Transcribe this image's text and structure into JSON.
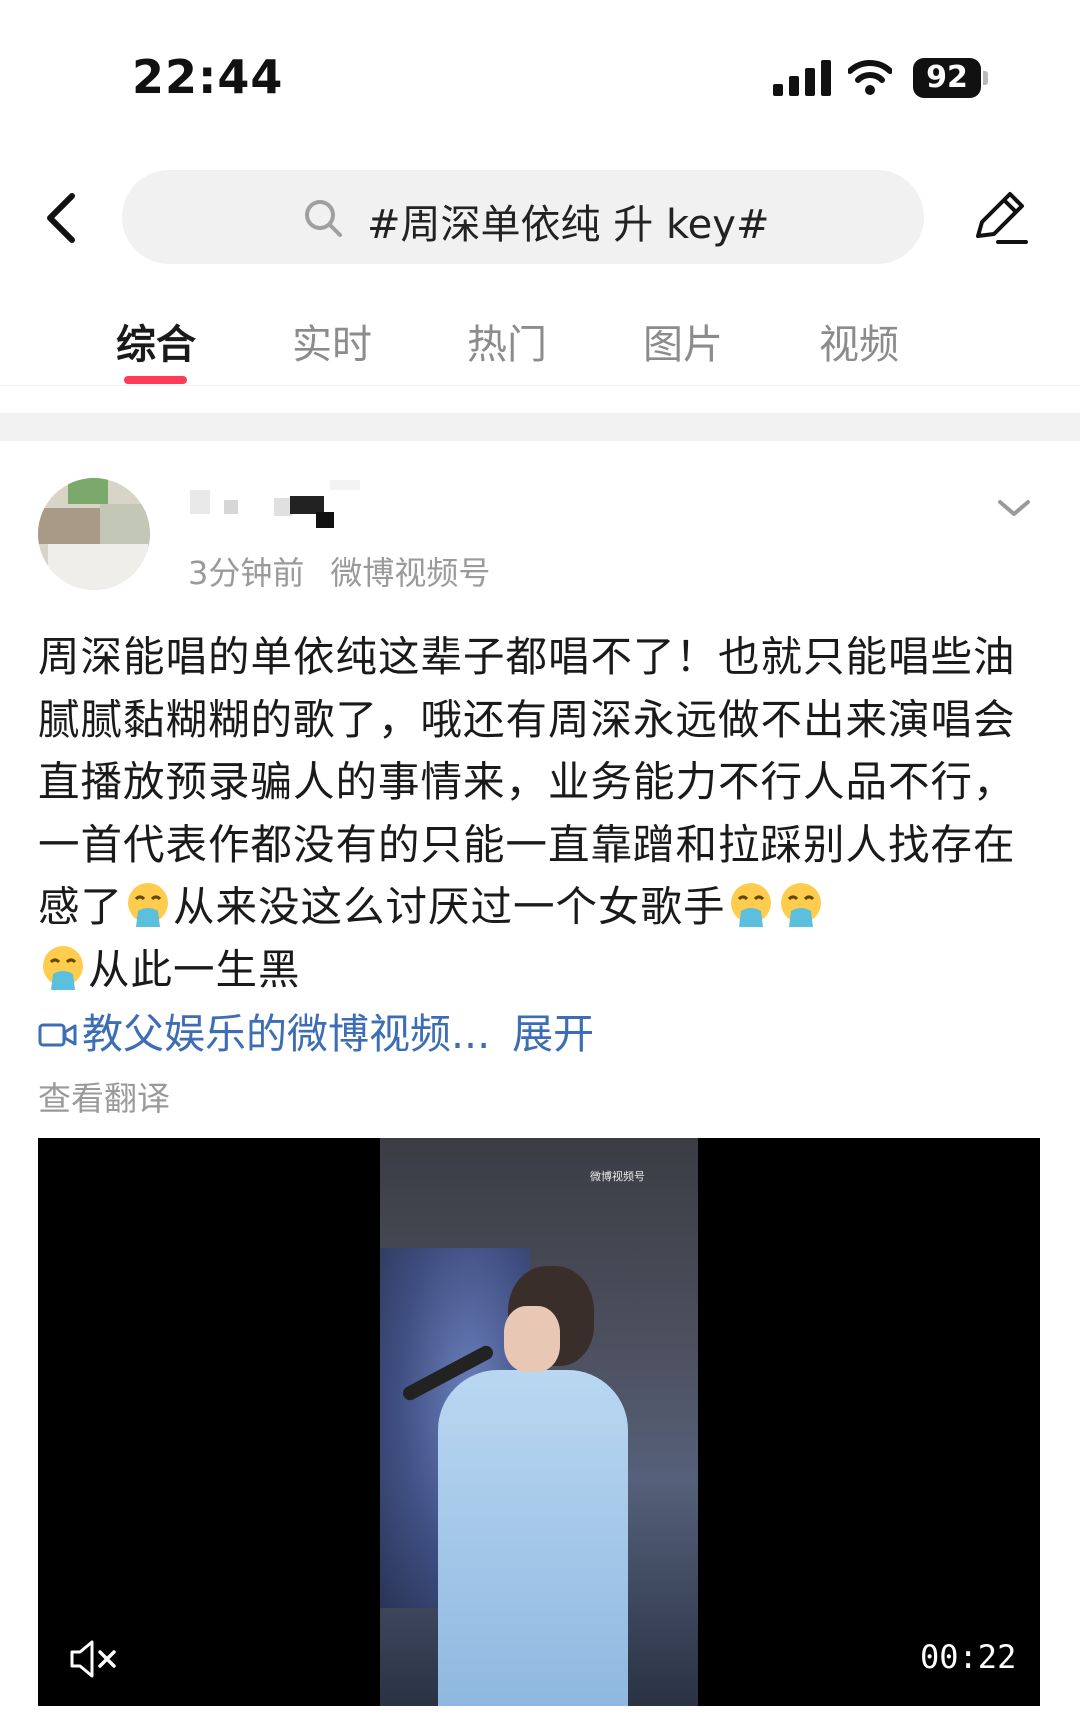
{
  "status_bar": {
    "time": "22:44",
    "battery": "92",
    "icons": [
      "cellular-signal-icon",
      "wifi-icon",
      "battery-icon"
    ]
  },
  "header": {
    "search_query": "#周深单依纯 升 key#",
    "icons": [
      "back-icon",
      "search-icon",
      "edit-icon"
    ]
  },
  "tabs": [
    {
      "label": "综合",
      "active": true
    },
    {
      "label": "实时",
      "active": false
    },
    {
      "label": "热门",
      "active": false
    },
    {
      "label": "图片",
      "active": false
    },
    {
      "label": "视频",
      "active": false
    }
  ],
  "post": {
    "timestamp": "3分钟前",
    "source": "微博视频号",
    "text_parts": [
      "周深能唱的单依纯这辈子都唱不了！也就只能唱些油腻腻黏糊糊的歌了，哦还有周深永远做不出来演唱会直播放预录骗人的事情来，业务能力不行人品不行，一首代表作都没有的只能一直靠蹭和拉踩别人找存在感了",
      "从来没这么讨厌过一个女歌手",
      "从此一生黑"
    ],
    "video_link": "教父娱乐的微博视频...",
    "expand": "展开",
    "translate": "查看翻译"
  },
  "video": {
    "duration": "00:22",
    "watermark": "微博视频号",
    "muted": true
  },
  "colors": {
    "accent": "#ff3b5c",
    "link": "#3d6db5",
    "muted_text": "#9a9a9a"
  }
}
